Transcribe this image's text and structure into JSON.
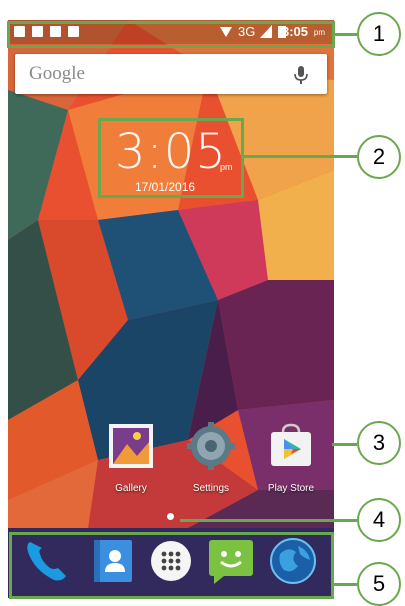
{
  "status_bar": {
    "network": "3G",
    "time": "3:05",
    "ampm": "pm"
  },
  "search": {
    "logo_text": "Google"
  },
  "clock": {
    "time": "3:05",
    "ampm": "pm",
    "date": "17/01/2016"
  },
  "apps": [
    {
      "label": "Gallery"
    },
    {
      "label": "Settings"
    },
    {
      "label": "Play Store"
    }
  ],
  "callouts": [
    "1",
    "2",
    "3",
    "4",
    "5"
  ],
  "colors": {
    "callout_green": "#6aa84f"
  }
}
